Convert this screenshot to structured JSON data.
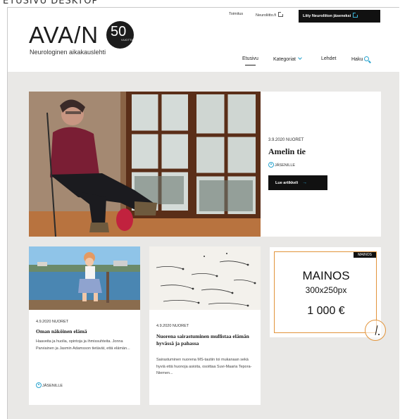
{
  "caption": "ETUSIVU DESKTOP",
  "header": {
    "logo_text": "AVA/N",
    "logo_badge_number": "50",
    "logo_badge_sub": "VUOTTA",
    "tagline": "Neurologinen aikakauslehti",
    "utility_links": [
      "Toimitus",
      "Neuroliitto.fi"
    ],
    "join_button": "Liity Neuroliiton jäseneksi",
    "nav": [
      "Etusivu",
      "Kategoriat",
      "Lehdet",
      "Haku"
    ],
    "accent_color": "#2aa4cf"
  },
  "hero": {
    "meta": "3.9.2020 NUORET",
    "title": "Amelin tie",
    "members_label": "JÄSENILLE",
    "read_button": "Lue artikkeli"
  },
  "cards": [
    {
      "meta": "4.9.2020 NUORET",
      "title": "Oman näköinen elämä",
      "excerpt": "Haaveita ja huolia, opintoja ja ihmissuhteita. Jonna Parviainen ja Jasmin Adamsson tietävät, että elämän...",
      "members_label": "JÄSENILLE"
    },
    {
      "meta": "4.9.2020 NUORET",
      "title": "Nuorena sairastuminen mullistaa elämän hyvässä ja pahassa",
      "excerpt": "Sairastuminen nuorena MS-tautiin toi mukanaan sekä hyviä että huonoja asioita, osoittaa Suvi-Maaria Tepora-Niemen..."
    }
  ],
  "ad": {
    "tag": "MAINOS",
    "title": "MAINOS",
    "size": "300x250px",
    "price": "1 000 €",
    "border_color": "#e2943b"
  }
}
